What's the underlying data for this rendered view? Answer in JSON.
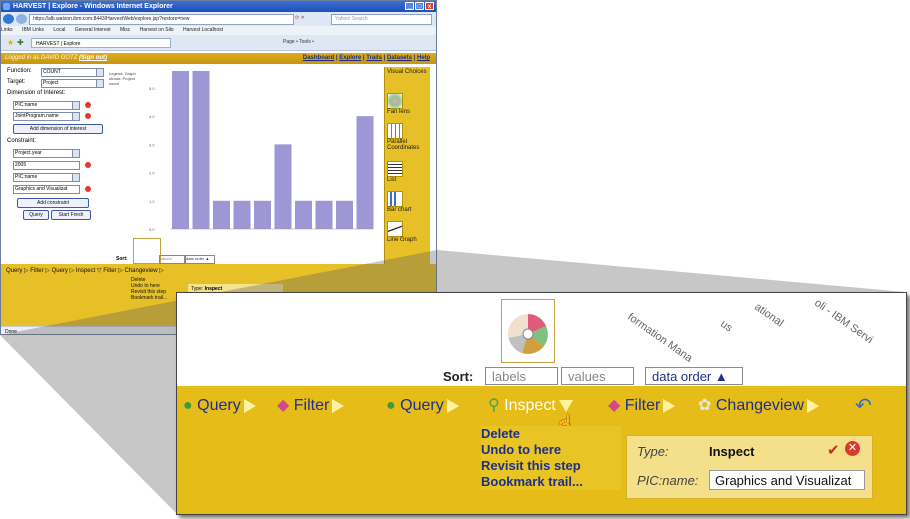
{
  "window": {
    "title": "HARVEST | Explore - Windows Internet Explorer",
    "url": "https://alb.watson.ibm.com:8443/HarvestWeb/explore.jsp?restore=new",
    "search_placeholder": "Yahoo! Search",
    "links": [
      "Links",
      "IBM Links",
      "Local",
      "General Interest",
      "Misc",
      "Harvest on Silo",
      "Harvest Localhost"
    ],
    "tab_label": "HARVEST | Explore",
    "tools_label": "Page • Tools •",
    "status": "Done"
  },
  "app": {
    "login_prefix": "Logged in as DAVID GOTZ",
    "sign_out": "(Sign out)",
    "nav": [
      "Dashboard",
      "Explore",
      "Trails",
      "Datasets",
      "Help"
    ]
  },
  "controls": {
    "function_label": "Function:",
    "function_value": "COUNT",
    "target_label": "Target:",
    "target_value": "Project",
    "dimension_label": "Dimension of Interest:",
    "dimensions": [
      "PIC:name",
      "JointProgram.name"
    ],
    "add_dimension": "Add dimension of interest",
    "constraint_label": "Constraint:",
    "constraint_field1": "Project.year",
    "constraint_value1": "2005",
    "constraint_field2": "PIC:name",
    "constraint_value2": "Graphics and Visualizat",
    "add_constraint": "Add constraint",
    "query_btn": "Query",
    "start_fresh_btn": "Start Fresh"
  },
  "chart_data": {
    "type": "bar",
    "legend_text": "Legend: Graph shows: Project count",
    "y_ticks": [
      "0.0",
      "1.0",
      "2.0",
      "3.0",
      "4.0",
      "5.0"
    ],
    "ylim": [
      0,
      5.6
    ],
    "values": [
      5.6,
      5.6,
      1,
      1,
      1,
      3,
      1,
      1,
      1,
      4
    ],
    "color": "#9d97d6"
  },
  "visual_choices": {
    "title": "Visual Choices",
    "items": [
      "Fan lens",
      "Parallel Coordinates",
      "List",
      "Bar chart",
      "Line Graph"
    ]
  },
  "sort": {
    "label": "Sort:",
    "options": [
      "labels",
      "values",
      "data order ▲"
    ]
  },
  "trail": {
    "steps": [
      "Query",
      "Filter",
      "Query",
      "Inspect",
      "Filter",
      "Changeview"
    ],
    "menu": [
      "Delete",
      "Undo to here",
      "Revisit this step",
      "Bookmark trail..."
    ]
  },
  "step_panel": {
    "type_key": "Type:",
    "type_value": "Inspect",
    "pic_key": "PIC:name:",
    "pic_value": "Graphics and Visualizat"
  },
  "zoom_axis_labels": [
    "formation Mana",
    "us",
    "ational",
    "oli - IBM Servi"
  ]
}
